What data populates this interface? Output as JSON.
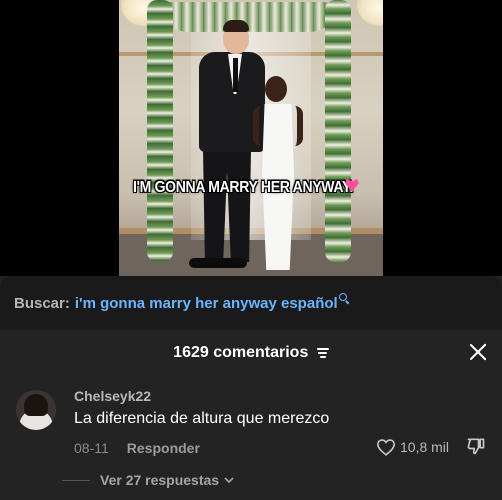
{
  "video": {
    "caption": "I'M GONNA MARRY HER ANYWAY."
  },
  "search": {
    "prefix": "Buscar:",
    "query": "i'm gonna marry her anyway español"
  },
  "comments_header": {
    "count_label": "1629 comentarios"
  },
  "comment": {
    "username": "Chelseyk22",
    "text": "La diferencia de altura que merezco",
    "date": "08-11",
    "reply_label": "Responder",
    "likes": "10,8 mil"
  },
  "replies": {
    "label": "Ver 27 respuestas"
  },
  "colors": {
    "accent_link": "#69b6ff",
    "sheet_bg": "#232323"
  }
}
